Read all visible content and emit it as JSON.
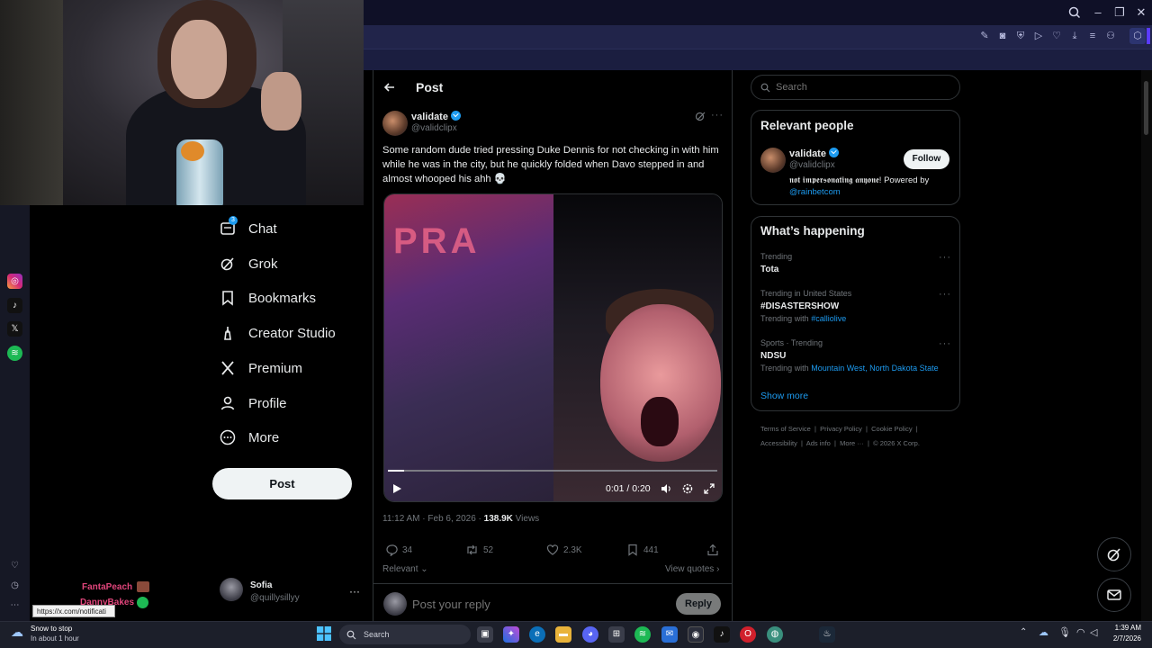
{
  "browser": {
    "window_controls": [
      "minimize",
      "maximize",
      "close"
    ]
  },
  "webcam": {
    "description_icon": "webcam-feed"
  },
  "side_strip": {
    "apps": [
      "instagram",
      "tiktok",
      "x",
      "spotify"
    ],
    "bottom": [
      "heart",
      "clock",
      "more"
    ]
  },
  "nav": {
    "chat": {
      "label": "Chat",
      "badge": "3"
    },
    "grok": {
      "label": "Grok"
    },
    "bookmarks": {
      "label": "Bookmarks"
    },
    "creator_studio": {
      "label": "Creator Studio"
    },
    "premium": {
      "label": "Premium"
    },
    "profile": {
      "label": "Profile"
    },
    "more": {
      "label": "More"
    },
    "post_button": "Post"
  },
  "account": {
    "name": "Sofia",
    "handle": "@quillysillyy"
  },
  "chat_overlay": {
    "user1": "FantaPeach",
    "user2": "DannyBakes"
  },
  "url_tooltip": "https://x.com/notificati",
  "notification": {
    "title": "Snow to stop",
    "subtitle": "In about 1 hour"
  },
  "post": {
    "header": "Post",
    "author_name": "validate",
    "author_handle": "@validclipx",
    "text": "Some random dude tried pressing Duke Dennis for not checking in with him while he was in the city, but he quickly folded when Davo stepped in and almost whooped his ahh 💀",
    "video": {
      "time": "0:01 / 0:20",
      "progress": 0.05
    },
    "timestamp": "11:12 AM · Feb 6, 2026 · ",
    "views_count": "138.9K",
    "views_label": " Views",
    "replies": "34",
    "reposts": "52",
    "likes": "2.3K",
    "bookmarks": "441",
    "sort": "Relevant",
    "view_quotes": "View quotes",
    "reply_placeholder": "Post your reply",
    "reply_button": "Reply"
  },
  "sidebar": {
    "search_placeholder": "Search",
    "relevant_people": {
      "title": "Relevant people",
      "name": "validate",
      "handle": "@validclipx",
      "follow": "Follow",
      "bio_styled": "𝖓𝖔𝖙 𝖎𝖒𝖕𝖊𝖗𝖘𝖔𝖓𝖆𝖙𝖎𝖓𝖌 𝖆𝖓𝖞𝖔𝖓𝖊!",
      "bio_rest": " Powered by",
      "bio_link": "@rainbetcom"
    },
    "happening": {
      "title": "What’s happening",
      "trends": [
        {
          "category": "Trending",
          "name": "Tota",
          "with_label": "",
          "with_links": ""
        },
        {
          "category": "Trending in United States",
          "name": "#DISASTERSHOW",
          "with_label": "Trending with ",
          "with_links": "#calliolive"
        },
        {
          "category": "Sports · Trending",
          "name": "NDSU",
          "with_label": "Trending with ",
          "with_links": "Mountain West, North Dakota State"
        }
      ],
      "show_more": "Show more"
    },
    "footer": {
      "line1": [
        "Terms of Service",
        "Privacy Policy",
        "Cookie Policy"
      ],
      "line2": [
        "Accessibility",
        "Ads info",
        "More ···",
        "© 2026 X Corp."
      ]
    }
  },
  "taskbar": {
    "search": "Search",
    "time": "1:39 AM",
    "date": "2/7/2026"
  }
}
